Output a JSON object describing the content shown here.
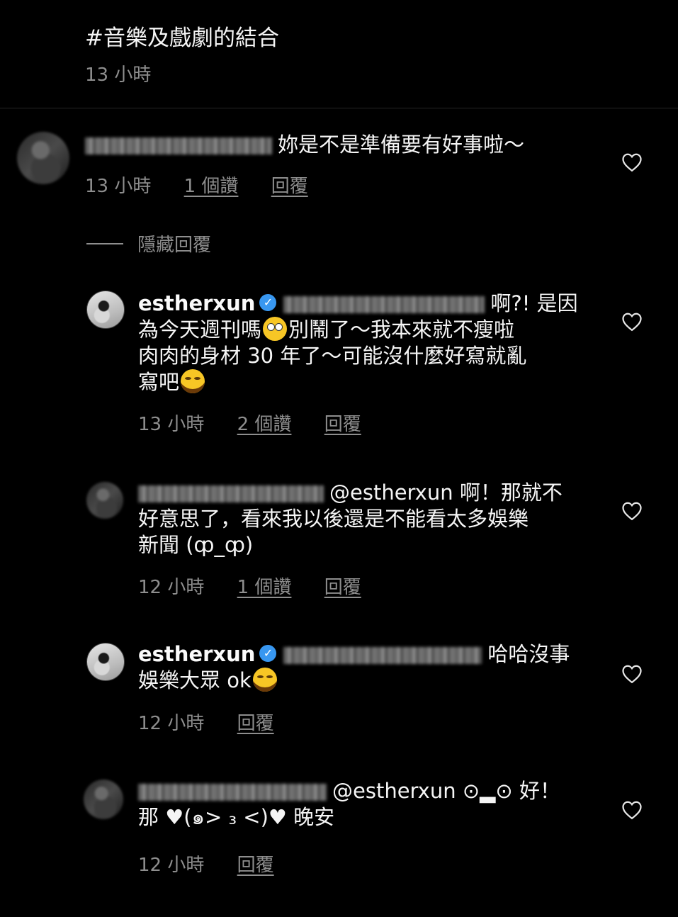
{
  "caption": {
    "hashtag": "#音樂及戲劇的結合",
    "time": "13 小時"
  },
  "hide_replies_label": "隱藏回覆",
  "comments": [
    {
      "text": "妳是不是準備要有好事啦～",
      "time": "13 小時",
      "likes": "1 個讚",
      "reply": "回覆"
    },
    {
      "username": "estherxun",
      "text_l1": "啊?! 是因",
      "text_l2a": "為今天週刊嗎",
      "text_l2b": "別鬧了～我本來就不瘦啦",
      "text_l3": "肉肉的身材 30 年了～可能沒什麼好寫就亂",
      "text_l4": "寫吧",
      "time": "13 小時",
      "likes": "2 個讚",
      "reply": "回覆"
    },
    {
      "l1": "@estherxun 啊！那就不",
      "l2": "好意思了，看來我以後還是不能看太多娛樂",
      "l3": "新聞 (ȹ_ȹ)",
      "time": "12 小時",
      "likes": "1 個讚",
      "reply": "回覆"
    },
    {
      "username": "estherxun",
      "l1": "哈哈沒事",
      "l2": "娛樂大眾 ok",
      "time": "12 小時",
      "reply": "回覆"
    },
    {
      "l1": "@estherxun ⊙▂⊙ 好！",
      "l2": "那 ♥(๑> ₃ <)♥ 晚安",
      "time": "12 小時",
      "reply": "回覆"
    }
  ],
  "icons": {
    "like": "heart-outline-icon",
    "verified": "verified-badge-icon"
  },
  "colors": {
    "background": "#000000",
    "text": "#f5f5f5",
    "muted": "#8e8e8e",
    "verified": "#3897f0"
  }
}
